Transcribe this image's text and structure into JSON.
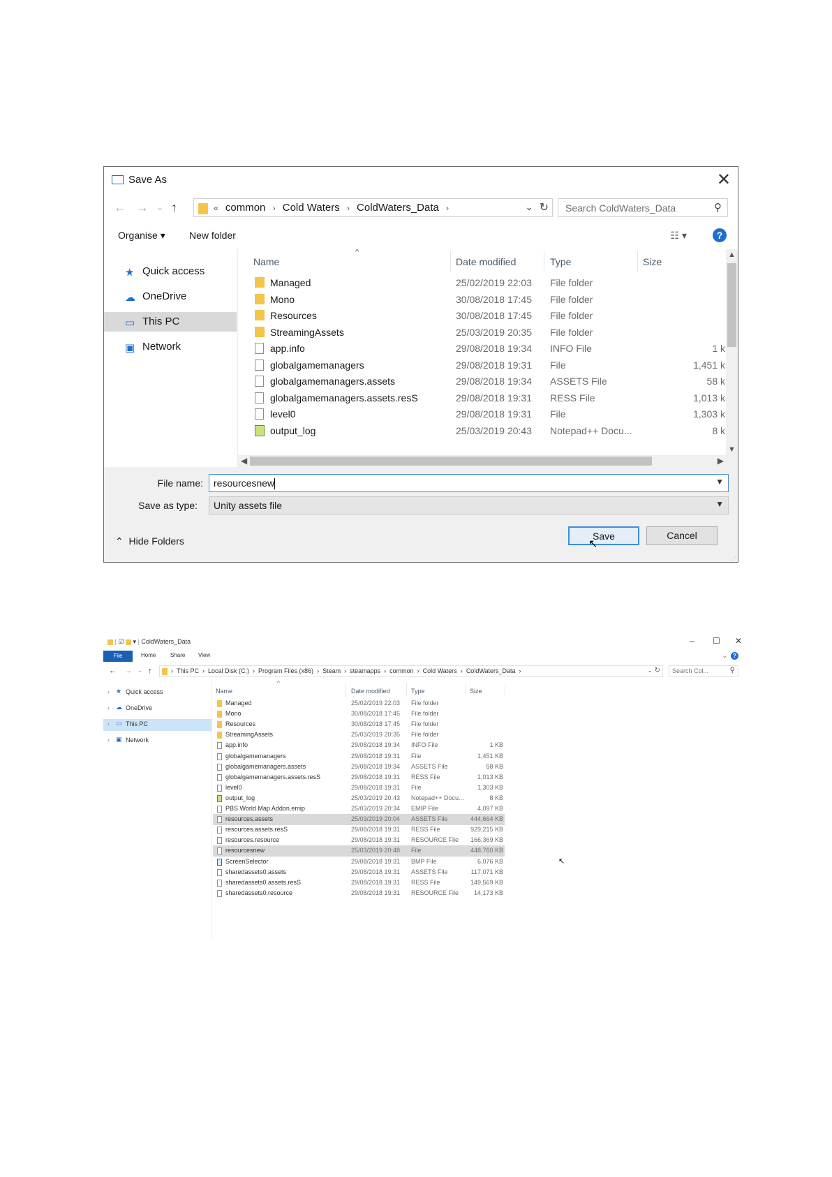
{
  "save_dialog": {
    "title": "Save As",
    "close_glyph": "✕",
    "nav_back": "←",
    "nav_forward": "→",
    "nav_recent": "⌄",
    "nav_up": "↑",
    "address": {
      "prefix": "«",
      "crumbs": [
        "common",
        "Cold Waters",
        "ColdWaters_Data"
      ],
      "separator": "›",
      "dropdown_glyph": "⌄",
      "refresh_glyph": "↻"
    },
    "search_placeholder": "Search ColdWaters_Data",
    "toolbar": {
      "organise": "Organise ▾",
      "new_folder": "New folder",
      "view_glyph": "☷ ▾",
      "help_glyph": "?"
    },
    "nav_pane": [
      {
        "label": "Quick access",
        "icon": "star-icon",
        "glyph": "★",
        "color": "#1e6fd0"
      },
      {
        "label": "OneDrive",
        "icon": "cloud-icon",
        "glyph": "☁",
        "color": "#1e6fd0"
      },
      {
        "label": "This PC",
        "icon": "monitor-icon",
        "glyph": "▭",
        "color": "#1e6fd0"
      },
      {
        "label": "Network",
        "icon": "network-icon",
        "glyph": "▣",
        "color": "#1e6fd0"
      }
    ],
    "columns": {
      "name": "Name",
      "date": "Date modified",
      "type": "Type",
      "size": "Size"
    },
    "files": [
      {
        "name": "Managed",
        "date": "25/02/2019 22:03",
        "type": "File folder",
        "size": "",
        "icon": "folder"
      },
      {
        "name": "Mono",
        "date": "30/08/2018 17:45",
        "type": "File folder",
        "size": "",
        "icon": "folder"
      },
      {
        "name": "Resources",
        "date": "30/08/2018 17:45",
        "type": "File folder",
        "size": "",
        "icon": "folder"
      },
      {
        "name": "StreamingAssets",
        "date": "25/03/2019 20:35",
        "type": "File folder",
        "size": "",
        "icon": "folder"
      },
      {
        "name": "app.info",
        "date": "29/08/2018 19:34",
        "type": "INFO File",
        "size": "1 k",
        "icon": "doc"
      },
      {
        "name": "globalgamemanagers",
        "date": "29/08/2018 19:31",
        "type": "File",
        "size": "1,451 k",
        "icon": "doc"
      },
      {
        "name": "globalgamemanagers.assets",
        "date": "29/08/2018 19:34",
        "type": "ASSETS File",
        "size": "58 k",
        "icon": "doc"
      },
      {
        "name": "globalgamemanagers.assets.resS",
        "date": "29/08/2018 19:31",
        "type": "RESS File",
        "size": "1,013 k",
        "icon": "doc"
      },
      {
        "name": "level0",
        "date": "29/08/2018 19:31",
        "type": "File",
        "size": "1,303 k",
        "icon": "doc"
      },
      {
        "name": "output_log",
        "date": "25/03/2019 20:43",
        "type": "Notepad++ Docu...",
        "size": "8 k",
        "icon": "np"
      }
    ],
    "file_name_label": "File name:",
    "file_name_value": "resourcesnew",
    "save_type_label": "Save as type:",
    "save_type_value": "Unity assets file",
    "hide_folders": "Hide Folders",
    "save_button": "Save",
    "cancel_button": "Cancel"
  },
  "explorer": {
    "window_title": "ColdWaters_Data",
    "ribbon_tabs": [
      "File",
      "Home",
      "Share",
      "View"
    ],
    "address_crumbs": [
      "This PC",
      "Local Disk (C:)",
      "Program Files (x86)",
      "Steam",
      "steamapps",
      "common",
      "Cold Waters",
      "ColdWaters_Data"
    ],
    "search_placeholder": "Search Col...",
    "nav_pane": [
      "Quick access",
      "OneDrive",
      "This PC",
      "Network"
    ],
    "columns": {
      "name": "Name",
      "date": "Date modified",
      "type": "Type",
      "size": "Size"
    },
    "files": [
      {
        "name": "Managed",
        "date": "25/02/2019 22:03",
        "type": "File folder",
        "size": "",
        "icon": "folder",
        "selected": false
      },
      {
        "name": "Mono",
        "date": "30/08/2018 17:45",
        "type": "File folder",
        "size": "",
        "icon": "folder",
        "selected": false
      },
      {
        "name": "Resources",
        "date": "30/08/2018 17:45",
        "type": "File folder",
        "size": "",
        "icon": "folder",
        "selected": false
      },
      {
        "name": "StreamingAssets",
        "date": "25/03/2019 20:35",
        "type": "File folder",
        "size": "",
        "icon": "folder",
        "selected": false
      },
      {
        "name": "app.info",
        "date": "29/08/2018 19:34",
        "type": "INFO File",
        "size": "1 KB",
        "icon": "doc",
        "selected": false
      },
      {
        "name": "globalgamemanagers",
        "date": "29/08/2018 19:31",
        "type": "File",
        "size": "1,451 KB",
        "icon": "doc",
        "selected": false
      },
      {
        "name": "globalgamemanagers.assets",
        "date": "29/08/2018 19:34",
        "type": "ASSETS File",
        "size": "58 KB",
        "icon": "doc",
        "selected": false
      },
      {
        "name": "globalgamemanagers.assets.resS",
        "date": "29/08/2018 19:31",
        "type": "RESS File",
        "size": "1,013 KB",
        "icon": "doc",
        "selected": false
      },
      {
        "name": "level0",
        "date": "29/08/2018 19:31",
        "type": "File",
        "size": "1,303 KB",
        "icon": "doc",
        "selected": false
      },
      {
        "name": "output_log",
        "date": "25/03/2019 20:43",
        "type": "Notepad++ Docu...",
        "size": "8 KB",
        "icon": "np",
        "selected": false
      },
      {
        "name": "PBS World Map Addon.emip",
        "date": "25/03/2019 20:34",
        "type": "EMIP File",
        "size": "4,097 KB",
        "icon": "doc",
        "selected": false
      },
      {
        "name": "resources.assets",
        "date": "25/03/2019 20:04",
        "type": "ASSETS File",
        "size": "444,664 KB",
        "icon": "doc",
        "selected": true
      },
      {
        "name": "resources.assets.resS",
        "date": "29/08/2018 19:31",
        "type": "RESS File",
        "size": "929,215 KB",
        "icon": "doc",
        "selected": false
      },
      {
        "name": "resources.resource",
        "date": "29/08/2018 19:31",
        "type": "RESOURCE File",
        "size": "166,369 KB",
        "icon": "doc",
        "selected": false
      },
      {
        "name": "resourcesnew",
        "date": "25/03/2019 20:48",
        "type": "File",
        "size": "448,760 KB",
        "icon": "doc",
        "selected": true
      },
      {
        "name": "ScreenSelector",
        "date": "29/08/2018 19:31",
        "type": "BMP File",
        "size": "6,076 KB",
        "icon": "bmp",
        "selected": false
      },
      {
        "name": "sharedassets0.assets",
        "date": "29/08/2018 19:31",
        "type": "ASSETS File",
        "size": "117,071 KB",
        "icon": "doc",
        "selected": false
      },
      {
        "name": "sharedassets0.assets.resS",
        "date": "29/08/2018 19:31",
        "type": "RESS File",
        "size": "149,569 KB",
        "icon": "doc",
        "selected": false
      },
      {
        "name": "sharedassets0.resource",
        "date": "29/08/2018 19:31",
        "type": "RESOURCE File",
        "size": "14,173 KB",
        "icon": "doc",
        "selected": false
      }
    ]
  }
}
